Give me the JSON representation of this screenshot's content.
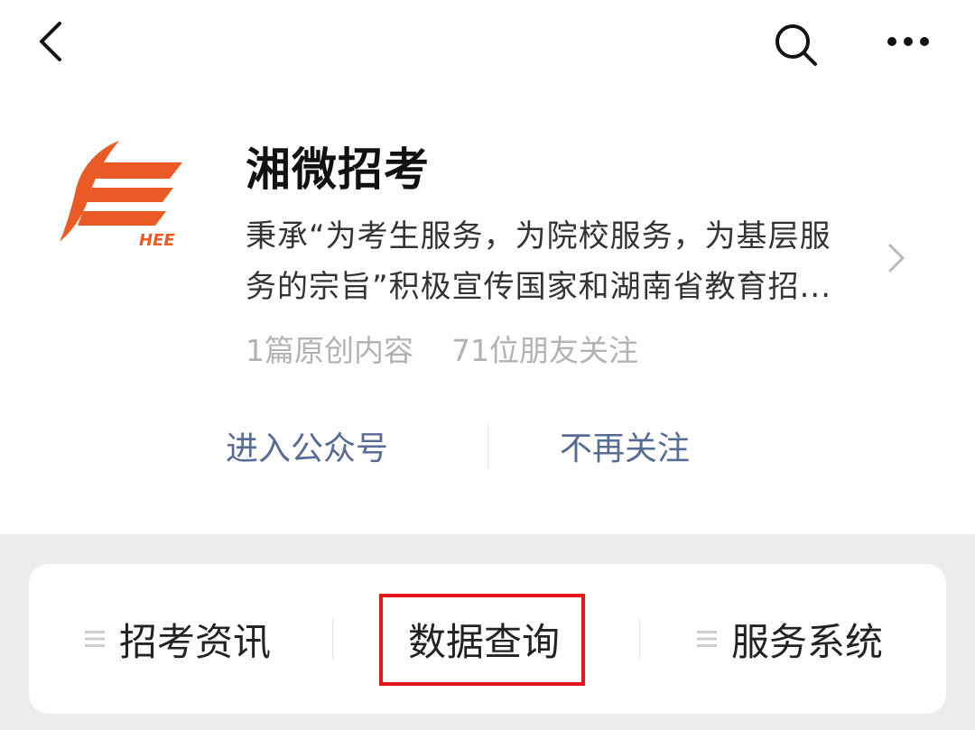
{
  "header": {
    "icons": [
      "back-icon",
      "search-icon",
      "more-icon"
    ]
  },
  "account": {
    "logo_text": "HEE",
    "name": "湘微招考",
    "description_line1": "秉承“为考生服务，为院校服务，为基层服",
    "description_line2": "务的宗旨”积极宣传国家和湖南省教育招...",
    "original_count": "1篇原创内容",
    "followers": "71位朋友关注"
  },
  "actions": {
    "enter": "进入公众号",
    "unfollow": "不再关注"
  },
  "menu": {
    "items": [
      {
        "label": "招考资讯",
        "has_submenu": true
      },
      {
        "label": "数据查询",
        "has_submenu": false,
        "highlighted": true
      },
      {
        "label": "服务系统",
        "has_submenu": true
      }
    ]
  },
  "colors": {
    "brand_orange": "#ea5a24",
    "link_blue": "#576b95",
    "highlight_red": "#e4161b",
    "page_gray": "#ededed"
  }
}
